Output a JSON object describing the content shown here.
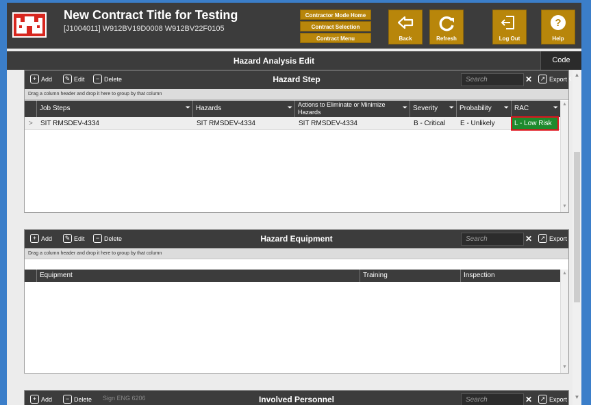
{
  "header": {
    "title": "New Contract Title for Testing",
    "subtitle": "[J1004011] W912BV19D0008  W912BV22F0105",
    "menu": [
      "Contractor Mode Home",
      "Contract Selection",
      "Contract Menu"
    ],
    "buttons": {
      "back": "Back",
      "refresh": "Refresh",
      "logout": "Log Out",
      "help": "Help"
    }
  },
  "page": {
    "title": "Hazard Analysis Edit",
    "code_matrix": "Code Matrix"
  },
  "colors": {
    "toolbar": "#3c3c3c",
    "accent": "#b8860b",
    "brand": "#d7261e",
    "rac_low": "#1e8a2d",
    "highlight": "#e0141e"
  },
  "common": {
    "add": "Add",
    "edit": "Edit",
    "delete": "Delete",
    "export": "Export",
    "search_placeholder": "Search",
    "group_hint": "Drag a column header and drop it here to group by that column"
  },
  "hazard_step": {
    "title": "Hazard Step",
    "columns": [
      "Job Steps",
      "Hazards",
      "Actions to Eliminate or Minimize Hazards",
      "Severity",
      "Probability",
      "RAC"
    ],
    "rows": [
      {
        "job_step": "SIT RMSDEV-4334",
        "hazard": "SIT RMSDEV-4334",
        "actions": "SIT RMSDEV-4334",
        "severity": "B - Critical",
        "probability": "E - Unlikely",
        "rac": "L - Low Risk"
      }
    ]
  },
  "hazard_equipment": {
    "title": "Hazard Equipment",
    "columns": [
      "Equipment",
      "Training",
      "Inspection"
    ]
  },
  "involved_personnel": {
    "title": "Involved Personnel",
    "sign_label": "Sign ENG 6206"
  }
}
